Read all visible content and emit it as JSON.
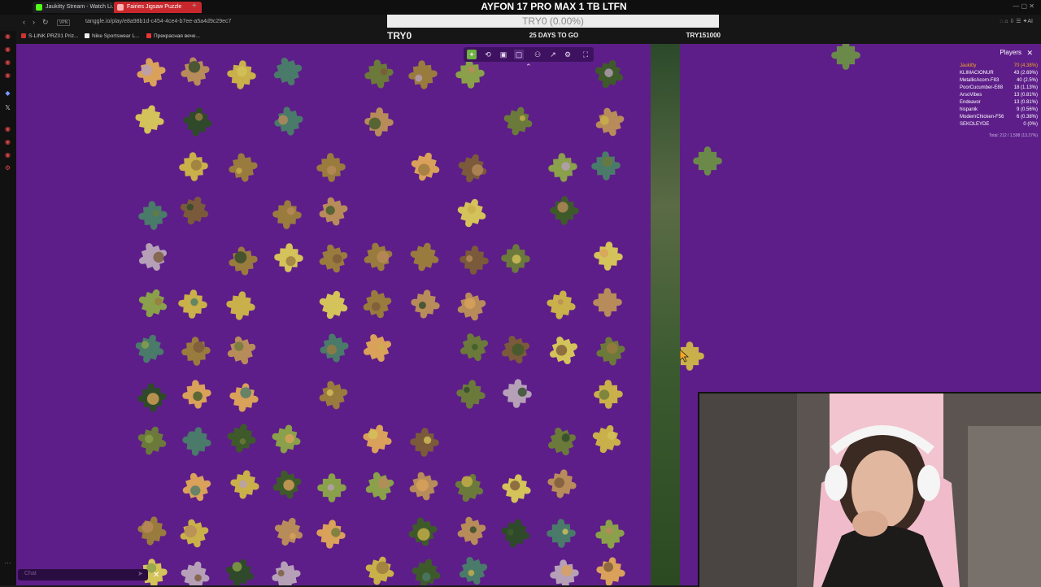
{
  "browser": {
    "tabs": [
      {
        "label": "Jaukitty Stream - Watch Li...",
        "active": false
      },
      {
        "label": "Fairies Jigsaw Puzzle",
        "active": true
      }
    ],
    "url": "tanggle.io/play/e8a98b1d-c454-4ce4-b7ee-a5a4d9c29ec7",
    "bookmarks": [
      "S-LINK PRZ01 Priz...",
      "Nike Sportswear L...",
      "Прекрасная вече..."
    ]
  },
  "overlay": {
    "title": "AYFON 17 PRO MAX 1 TB LTFN",
    "progress_text": "TRY0 (0.00%)",
    "left": "TRY0",
    "middle": "25 DAYS TO GO",
    "right": "TRY151000",
    "progress": 0
  },
  "players": {
    "title": "Players",
    "list": [
      {
        "name": "Jaukitty",
        "score": "70 (4.38%)",
        "highlight": true
      },
      {
        "name": "KLIMACIONUR",
        "score": "43 (2.69%)",
        "highlight": false
      },
      {
        "name": "MetallicAcorn-F83",
        "score": "40 (2.5%)",
        "highlight": false
      },
      {
        "name": "PoorCucumber-E88",
        "score": "18 (1.13%)",
        "highlight": false
      },
      {
        "name": "ArsoVibes",
        "score": "13 (0.81%)",
        "highlight": false
      },
      {
        "name": "Endeavor",
        "score": "13 (0.81%)",
        "highlight": false
      },
      {
        "name": "hispanik",
        "score": "9 (0.56%)",
        "highlight": false
      },
      {
        "name": "ModernChicken-F56",
        "score": "6 (0.38%)",
        "highlight": false
      },
      {
        "name": "SEKOLEYDE",
        "score": "0 (0%)",
        "highlight": false
      }
    ],
    "total": "Total: 212 / 1,598 (13.27%)"
  },
  "chat": {
    "placeholder": "Chat"
  },
  "colors": {
    "board": "#5d1e89",
    "toolbar": "#3e1260",
    "highlight": "#f5a623"
  },
  "icons": [
    "puzzle-icon",
    "rotate-icon",
    "image-icon",
    "box-icon",
    "users-icon",
    "share-icon",
    "settings-icon",
    "fullscreen-icon"
  ]
}
